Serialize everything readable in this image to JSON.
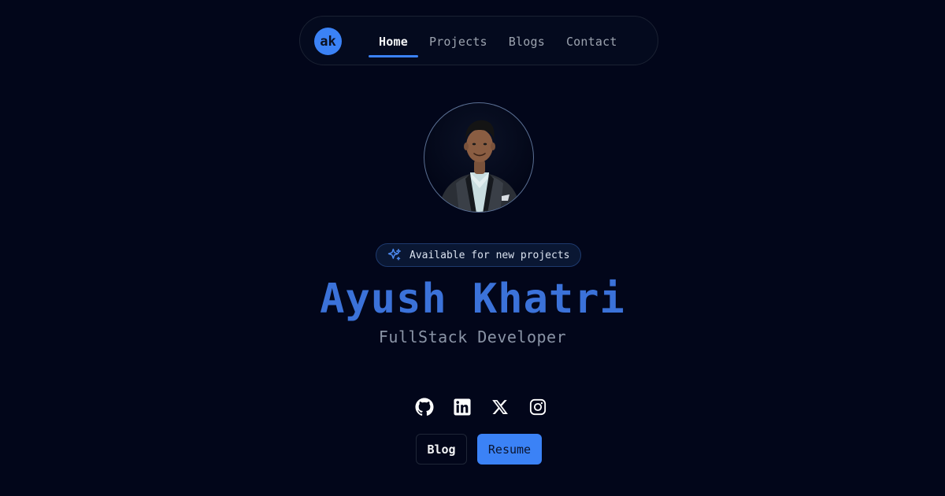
{
  "nav": {
    "logo_text": "ak",
    "links": [
      {
        "label": "Home",
        "active": true
      },
      {
        "label": "Projects",
        "active": false
      },
      {
        "label": "Blogs",
        "active": false
      },
      {
        "label": "Contact",
        "active": false
      }
    ]
  },
  "hero": {
    "badge_text": "Available for new projects",
    "badge_icon": "sparkles-icon",
    "name": "Ayush Khatri",
    "role": "FullStack Developer"
  },
  "socials": [
    {
      "icon": "github-icon"
    },
    {
      "icon": "linkedin-icon"
    },
    {
      "icon": "x-icon"
    },
    {
      "icon": "instagram-icon"
    }
  ],
  "buttons": {
    "blog_label": "Blog",
    "resume_label": "Resume"
  },
  "colors": {
    "background": "#02061a",
    "accent": "#3b82f6",
    "name": "#3b72d9",
    "muted": "#8a94a6"
  }
}
